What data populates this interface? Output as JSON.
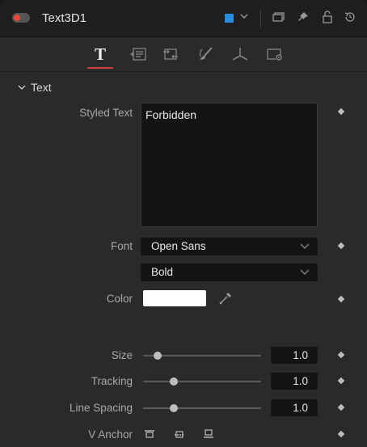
{
  "node": {
    "title": "Text3D1",
    "color_chip": "#2a8de0",
    "status_dot": "#e84a3c"
  },
  "titlebar_icons": [
    "color-dropdown-chevron-icon",
    "duplicate-window-icon",
    "pin-icon",
    "lock-icon",
    "reset-icon"
  ],
  "tabs": [
    {
      "name": "text",
      "icon": "T"
    },
    {
      "name": "layout",
      "icon": "layout-icon"
    },
    {
      "name": "transform",
      "icon": "transform-icon"
    },
    {
      "name": "shading",
      "icon": "brush-icon"
    },
    {
      "name": "3d",
      "icon": "axis-icon"
    },
    {
      "name": "settings",
      "icon": "settings-icon"
    }
  ],
  "section": {
    "title": "Text"
  },
  "styled_text": {
    "label": "Styled Text",
    "value": "Forbidden"
  },
  "font": {
    "label": "Font",
    "family": "Open Sans",
    "style": "Bold"
  },
  "color": {
    "label": "Color",
    "value": "#ffffff"
  },
  "sliders": [
    {
      "label": "Size",
      "value": "1.0",
      "fraction": 0.12
    },
    {
      "label": "Tracking",
      "value": "1.0",
      "fraction": 0.26
    },
    {
      "label": "Line Spacing",
      "value": "1.0",
      "fraction": 0.26
    }
  ],
  "v_anchor": {
    "label": "V Anchor",
    "options": [
      "top",
      "baseline",
      "bottom"
    ]
  }
}
